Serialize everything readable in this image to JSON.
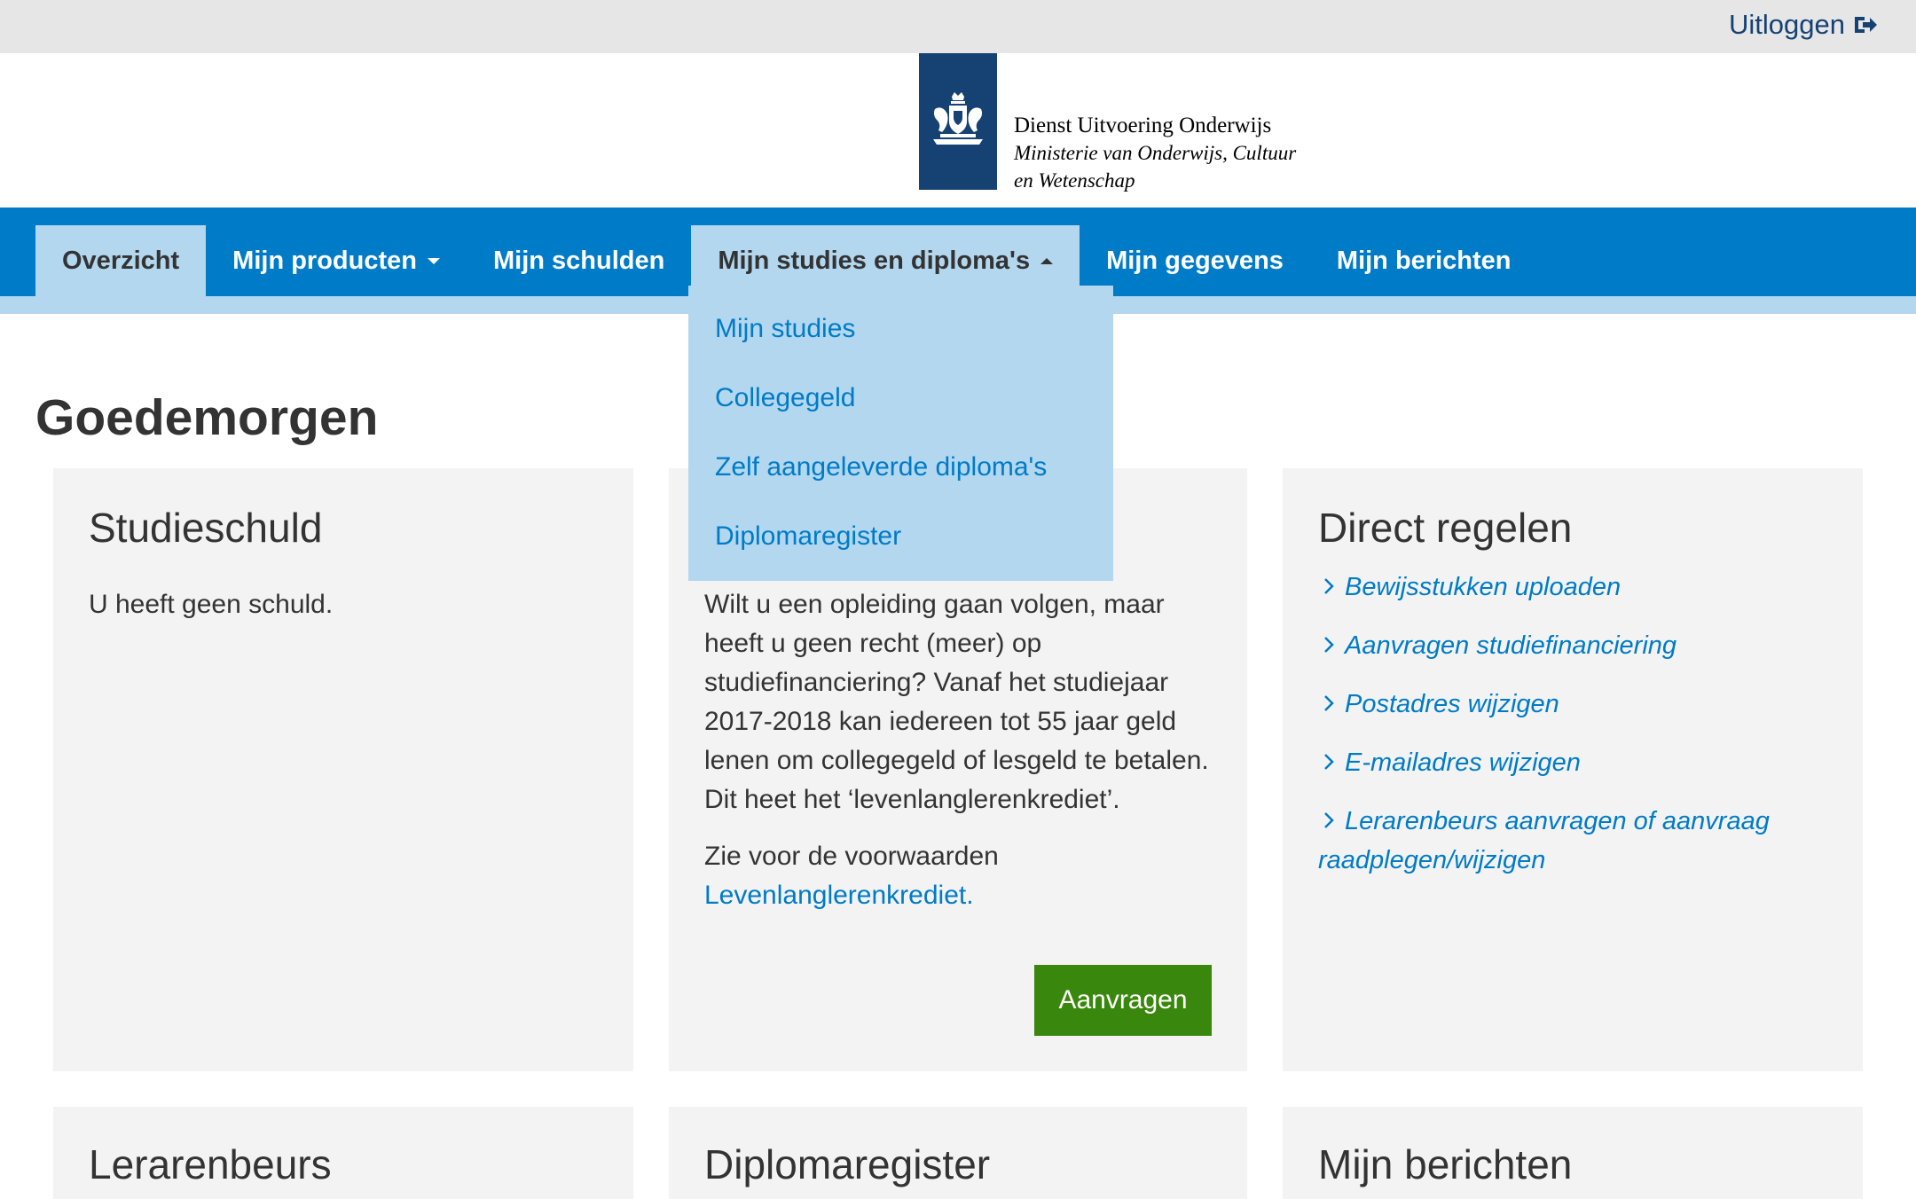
{
  "topbar": {
    "logout_label": "Uitloggen"
  },
  "header": {
    "org_name": "Dienst Uitvoering Onderwijs",
    "ministry": "Ministerie van Onderwijs, Cultuur en Wetenschap"
  },
  "nav": {
    "items": [
      {
        "label": "Overzicht"
      },
      {
        "label": "Mijn producten"
      },
      {
        "label": "Mijn schulden"
      },
      {
        "label": "Mijn studies en diploma's"
      },
      {
        "label": "Mijn gegevens"
      },
      {
        "label": "Mijn berichten"
      }
    ],
    "dropdown": [
      {
        "label": "Mijn studies"
      },
      {
        "label": "Collegegeld"
      },
      {
        "label": "Zelf aangeleverde diploma's"
      },
      {
        "label": "Diplomaregister"
      }
    ]
  },
  "greeting": "Goedemorgen",
  "cards": {
    "studieschuld": {
      "title": "Studieschuld",
      "text": "U heeft geen schuld."
    },
    "krediet": {
      "text": "Wilt u een opleiding gaan volgen, maar heeft u geen recht (meer) op studiefinanciering? Vanaf het studiejaar 2017-2018 kan iedereen tot 55 jaar geld lenen om collegegeld of lesgeld te betalen. Dit heet het ‘levenlanglerenkrediet’.",
      "conditions_text": "Zie voor de voorwaarden",
      "conditions_link": "Levenlanglerenkrediet.",
      "button": "Aanvragen"
    },
    "direct": {
      "title": "Direct regelen",
      "links": [
        {
          "label": "Bewijsstukken uploaden"
        },
        {
          "label": "Aanvragen studiefinanciering"
        },
        {
          "label": "Postadres wijzigen"
        },
        {
          "label": "E-mailadres wijzigen"
        },
        {
          "label": "Lerarenbeurs aanvragen of aanvraag raadplegen/wijzigen"
        }
      ]
    },
    "lerarenbeurs": {
      "title": "Lerarenbeurs"
    },
    "diplomaregister": {
      "title": "Diplomaregister"
    },
    "berichten": {
      "title": "Mijn berichten"
    }
  },
  "colors": {
    "brand_dark": "#154273",
    "nav_blue": "#007bc7",
    "nav_light": "#b2d7ee",
    "button_green": "#39870c",
    "card_bg": "#f3f3f3"
  }
}
